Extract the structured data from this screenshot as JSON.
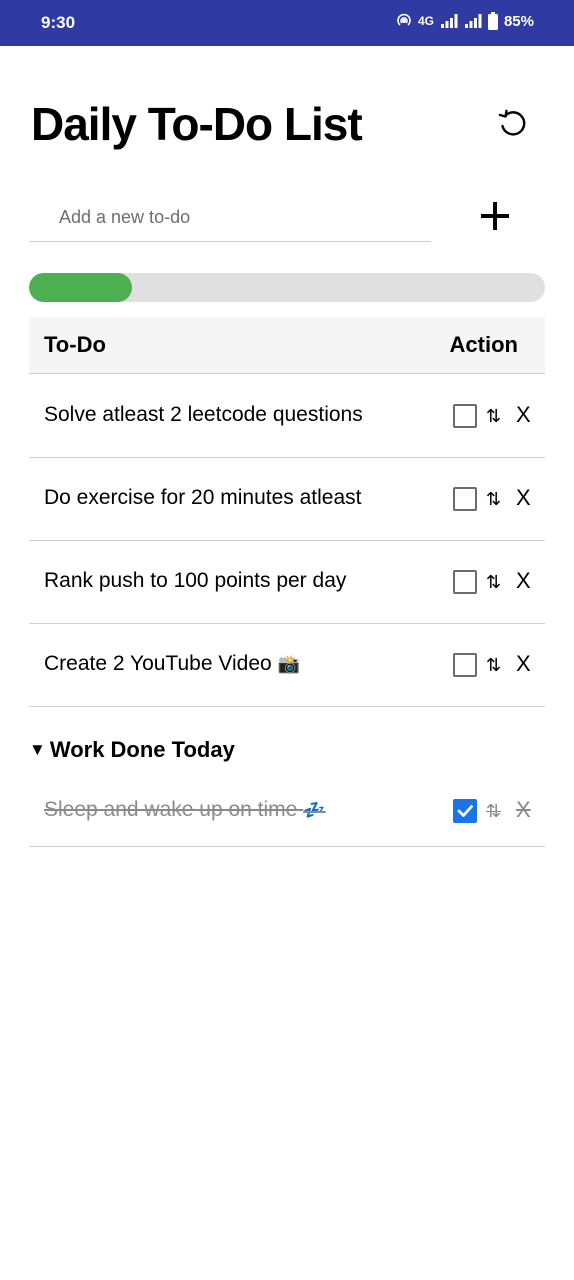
{
  "status_bar": {
    "time": "9:30",
    "network": "4G",
    "battery": "85%"
  },
  "header": {
    "title": "Daily To-Do List",
    "reset_icon": "reset-icon"
  },
  "new_todo": {
    "placeholder": "Add a new to-do",
    "value": "",
    "add_icon": "plus-icon"
  },
  "progress": {
    "fraction": 0.2
  },
  "table": {
    "columns": [
      "To-Do",
      "Action"
    ],
    "todos": [
      {
        "text": "Solve atleast 2 leetcode questions",
        "checked": false,
        "sort_label": "⇅",
        "delete_label": "X"
      },
      {
        "text": "Do exercise for 20 minutes atleast",
        "checked": false,
        "sort_label": "⇅",
        "delete_label": "X"
      },
      {
        "text": "Rank push to 100 points per day",
        "checked": false,
        "sort_label": "⇅",
        "delete_label": "X"
      },
      {
        "text": "Create 2 YouTube Video",
        "emoji": "📸",
        "checked": false,
        "sort_label": "⇅",
        "delete_label": "X"
      }
    ]
  },
  "done_section": {
    "arrow": "▼",
    "title": "Work Done Today",
    "items": [
      {
        "text": "Sleep and wake up on time",
        "emoji": "💤",
        "checked": true,
        "sort_label": "⇅",
        "delete_label": "X"
      }
    ]
  },
  "colors": {
    "status_bar": "#2f3ba2",
    "progress_fill": "#4caf50",
    "progress_track": "#e0e0e0",
    "checkbox_checked": "#1a73e8"
  }
}
